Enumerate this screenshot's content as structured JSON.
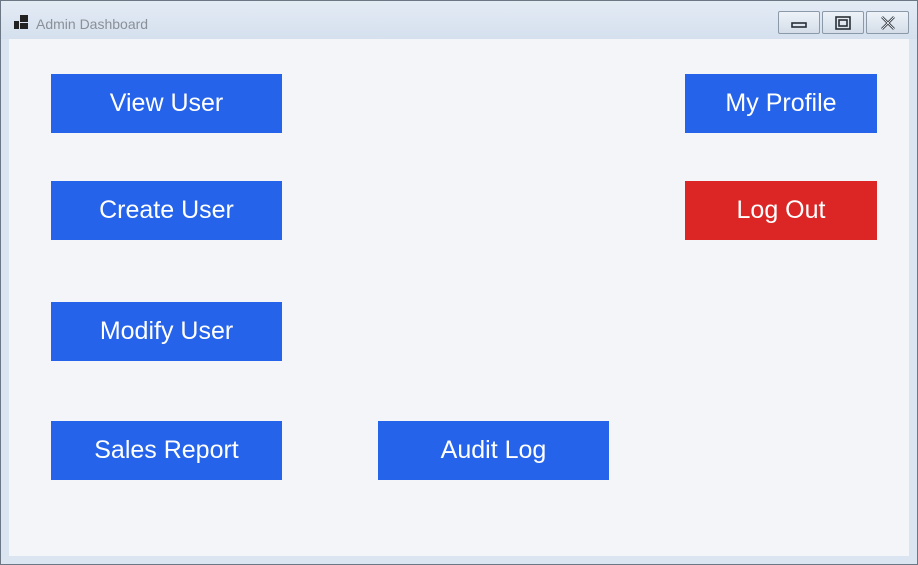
{
  "window": {
    "title": "Admin Dashboard"
  },
  "buttons": {
    "view_user": "View User",
    "create_user": "Create User",
    "modify_user": "Modify User",
    "sales_report": "Sales Report",
    "audit_log": "Audit Log",
    "my_profile": "My Profile",
    "log_out": "Log Out"
  },
  "icons": {
    "app": "app-icon",
    "minimize": "minimize-icon",
    "maximize": "maximize-icon",
    "close": "close-icon"
  },
  "colors": {
    "primary": "#2563eb",
    "danger": "#dc2626",
    "background": "#f3f5f9"
  }
}
